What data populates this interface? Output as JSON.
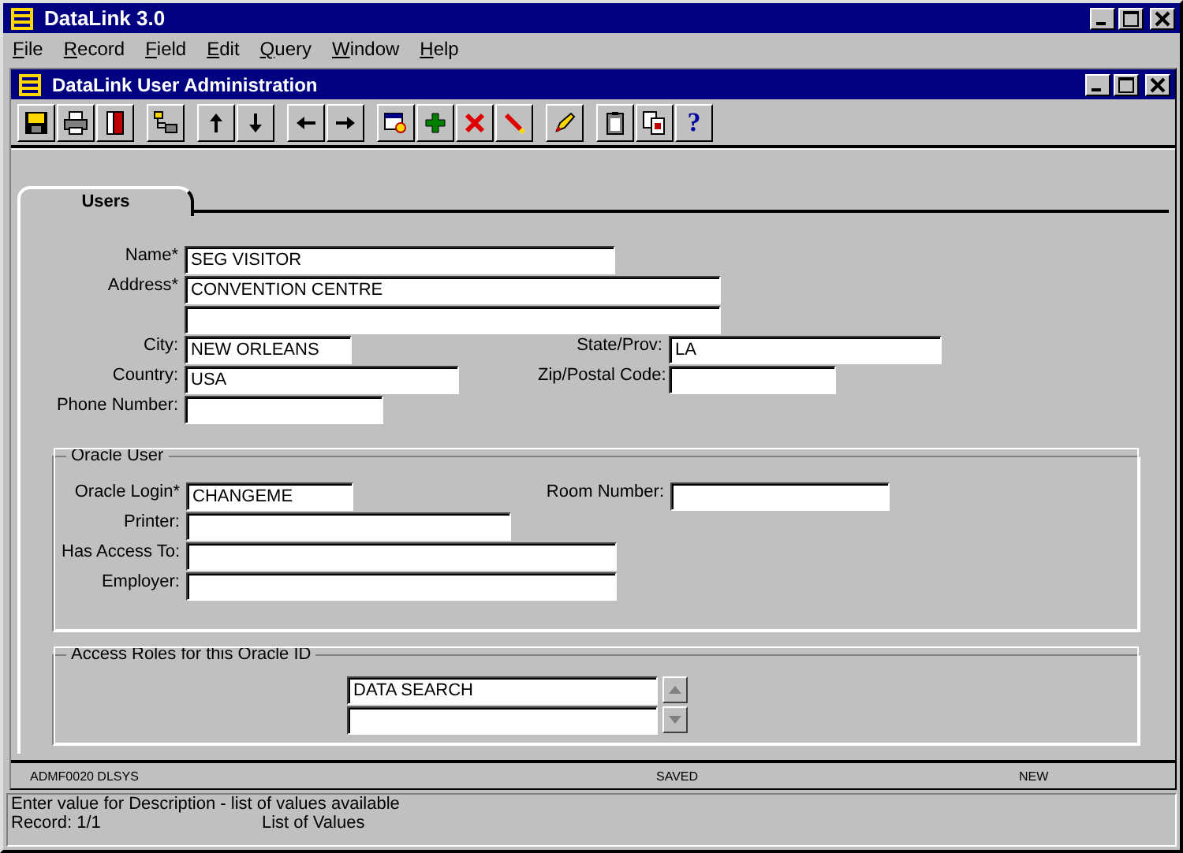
{
  "app": {
    "title": "DataLink 3.0"
  },
  "menu": [
    {
      "label": "File"
    },
    {
      "label": "Record"
    },
    {
      "label": "Field"
    },
    {
      "label": "Edit"
    },
    {
      "label": "Query"
    },
    {
      "label": "Window"
    },
    {
      "label": "Help"
    }
  ],
  "window": {
    "title": "DataLink User Administration"
  },
  "toolbar": [
    {
      "kind": "save"
    },
    {
      "kind": "print"
    },
    {
      "kind": "exit"
    },
    {
      "kind": "sep"
    },
    {
      "kind": "tree"
    },
    {
      "kind": "sep"
    },
    {
      "kind": "up"
    },
    {
      "kind": "down"
    },
    {
      "kind": "sep"
    },
    {
      "kind": "left"
    },
    {
      "kind": "right"
    },
    {
      "kind": "sep"
    },
    {
      "kind": "find"
    },
    {
      "kind": "add"
    },
    {
      "kind": "delete"
    },
    {
      "kind": "clear"
    },
    {
      "kind": "sep"
    },
    {
      "kind": "edit"
    },
    {
      "kind": "sep"
    },
    {
      "kind": "paste"
    },
    {
      "kind": "copy"
    },
    {
      "kind": "help",
      "glyph": "?"
    }
  ],
  "tabs": [
    {
      "label": "Users",
      "selected": true
    }
  ],
  "user_fields": [
    {
      "label": "Name*",
      "value": "SEG VISITOR"
    },
    {
      "label": "Address*",
      "value": "CONVENTION CENTRE"
    },
    {
      "label": "City:",
      "value": "NEW ORLEANS"
    },
    {
      "label": "State/Prov:",
      "value": "LA"
    },
    {
      "label": "Country:",
      "value": "USA"
    },
    {
      "label": "Zip/Postal Code:"
    },
    {
      "label": "Phone Number:"
    }
  ],
  "oracle_user": {
    "title": "Oracle User",
    "fields": [
      {
        "label": "Oracle Login*",
        "value": "CHANGEME"
      },
      {
        "label": "Room Number:"
      },
      {
        "label": "Printer:"
      },
      {
        "label": "Has Access To:"
      },
      {
        "label": "Employer:"
      }
    ]
  },
  "access_roles": {
    "title": "Access Roles for this Oracle ID",
    "rows": [
      "DATA SEARCH"
    ]
  },
  "status": {
    "form": "ADMF0020 DLSYS",
    "record_state": "SAVED",
    "mode": "NEW"
  },
  "message_bar": {
    "message": "Enter value for Description - list of values available",
    "record": "Record: 1/1",
    "lov": "List of Values"
  }
}
